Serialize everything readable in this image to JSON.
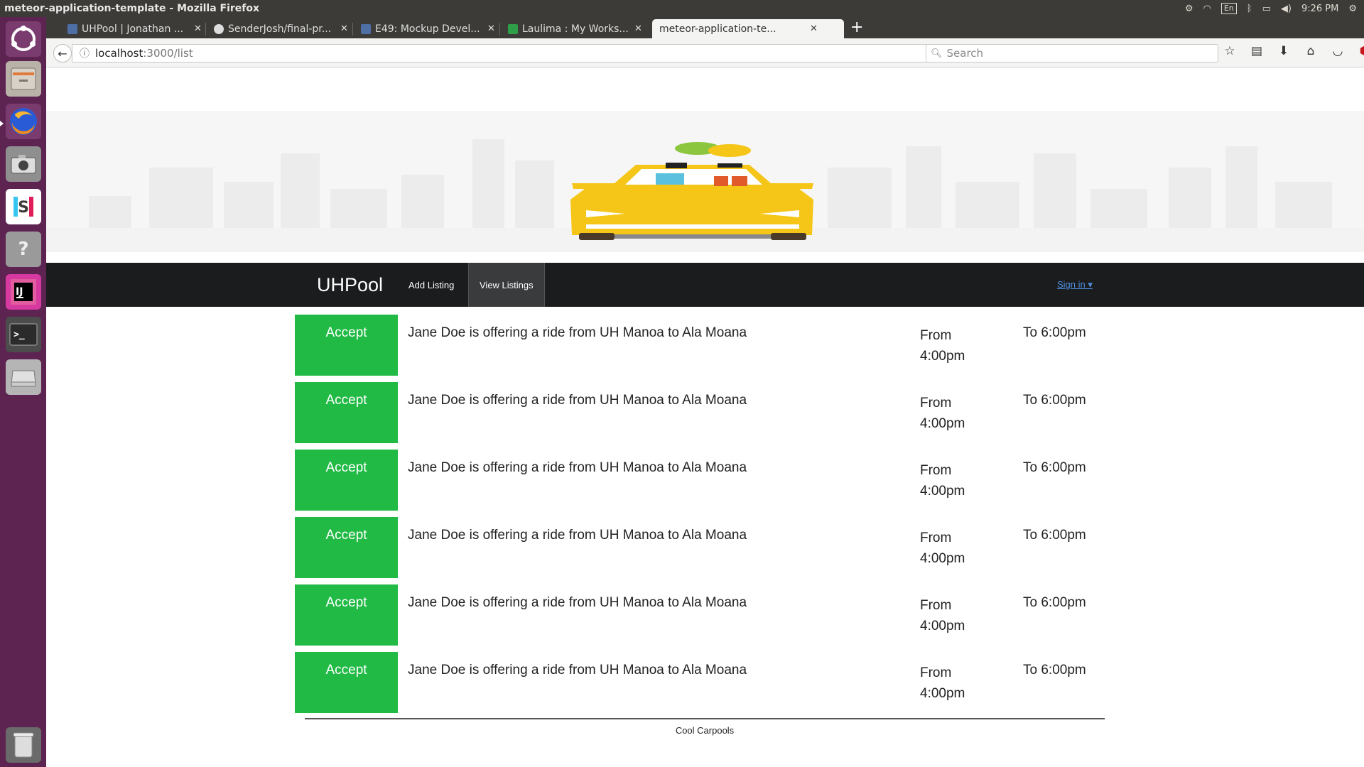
{
  "system": {
    "window_title": "meteor-application-template - Mozilla Firefox",
    "keyboard_layout": "En",
    "clock": "9:26 PM"
  },
  "browser": {
    "tabs": [
      {
        "label": "UHPool | Jonathan ...",
        "favicon": "page-icon"
      },
      {
        "label": "SenderJosh/final-pr...",
        "favicon": "github-icon"
      },
      {
        "label": "E49: Mockup Devel...",
        "favicon": "page-icon"
      },
      {
        "label": "Laulima : My Works...",
        "favicon": "laulima-icon"
      },
      {
        "label": "meteor-application-te...",
        "favicon": "none"
      }
    ],
    "url_host": "localhost",
    "url_path": ":3000/list",
    "search_placeholder": "Search"
  },
  "site": {
    "brand": "UHPool",
    "nav": {
      "add_listing": "Add Listing",
      "view_listings": "View Listings",
      "sign_in": "Sign in ▾"
    },
    "listings": [
      {
        "accept": "Accept",
        "description": "Jane Doe is offering a ride from UH Manoa to Ala Moana",
        "from": "From 4:00pm",
        "to": "To 6:00pm"
      },
      {
        "accept": "Accept",
        "description": "Jane Doe is offering a ride from UH Manoa to Ala Moana",
        "from": "From 4:00pm",
        "to": "To 6:00pm"
      },
      {
        "accept": "Accept",
        "description": "Jane Doe is offering a ride from UH Manoa to Ala Moana",
        "from": "From 4:00pm",
        "to": "To 6:00pm"
      },
      {
        "accept": "Accept",
        "description": "Jane Doe is offering a ride from UH Manoa to Ala Moana",
        "from": "From 4:00pm",
        "to": "To 6:00pm"
      },
      {
        "accept": "Accept",
        "description": "Jane Doe is offering a ride from UH Manoa to Ala Moana",
        "from": "From 4:00pm",
        "to": "To 6:00pm"
      },
      {
        "accept": "Accept",
        "description": "Jane Doe is offering a ride from UH Manoa to Ala Moana",
        "from": "From 4:00pm",
        "to": "To 6:00pm"
      }
    ],
    "footer": "Cool Carpools"
  },
  "colors": {
    "accept_green": "#21ba45",
    "nav_dark": "#1b1c1d",
    "car_yellow": "#f5c518",
    "launcher_purple": "#5d2452"
  }
}
